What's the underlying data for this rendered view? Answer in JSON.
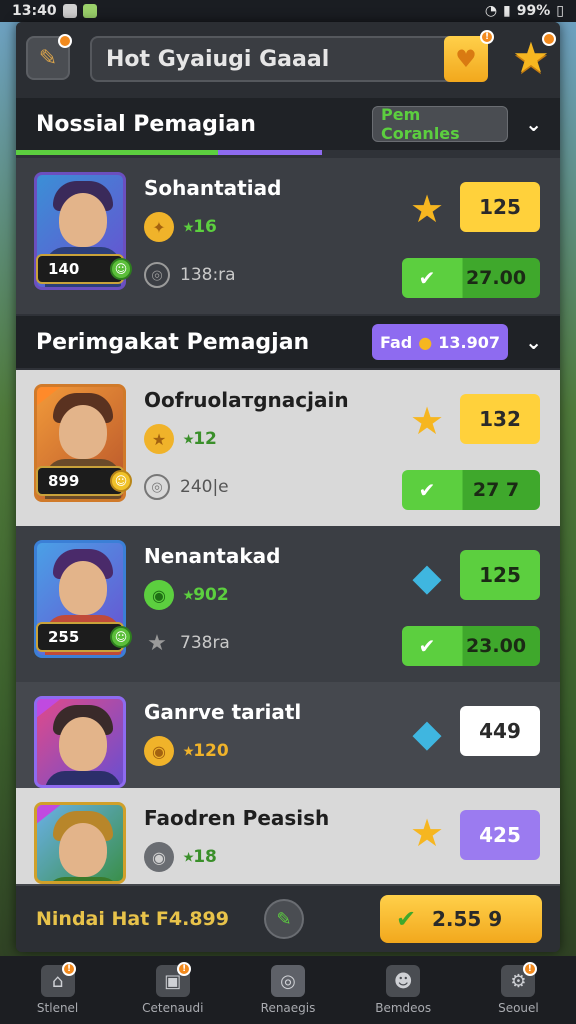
{
  "status": {
    "time": "13:40",
    "battery": "99%"
  },
  "topbar": {
    "search_text": "Hot Gyaiugi Gaaal",
    "badge": "!"
  },
  "section1": {
    "title": "Nossial Pemagian",
    "chip": "Pem Coranles"
  },
  "section2": {
    "title": "Perimgakat Pemagjan",
    "chip_label": "Fad",
    "chip_value": "13.907"
  },
  "rows": [
    {
      "name": "Sohantatiad",
      "level": "140",
      "bonus": "16",
      "sub": "138:ra",
      "score": "125",
      "value": "27.00"
    },
    {
      "name": "Oofruolaтgnacjain",
      "level": "899",
      "bonus": "12",
      "sub": "240|e",
      "score": "132",
      "value": "27 7"
    },
    {
      "name": "Nenantakad",
      "level": "255",
      "bonus": "902",
      "sub": "738ra",
      "score": "125",
      "value": "23.00"
    },
    {
      "name": "Ganrve tariatl",
      "bonus": "120",
      "score": "449"
    },
    {
      "name": "Faodren Peasish",
      "bonus": "18",
      "score": "425"
    }
  ],
  "footer": {
    "text": "Nindai Hat F4.899",
    "btn_value": "2.55 9"
  },
  "nav": [
    {
      "label": "Stlenel",
      "badge": "!"
    },
    {
      "label": "Cetenaudi",
      "badge": "!"
    },
    {
      "label": "Renaegis"
    },
    {
      "label": "Bemdeos"
    },
    {
      "label": "Seouel",
      "badge": "!"
    }
  ],
  "colors": {
    "accent_green": "#5ccf3f",
    "accent_gold": "#f6b620",
    "accent_purple": "#8e6bf0"
  }
}
